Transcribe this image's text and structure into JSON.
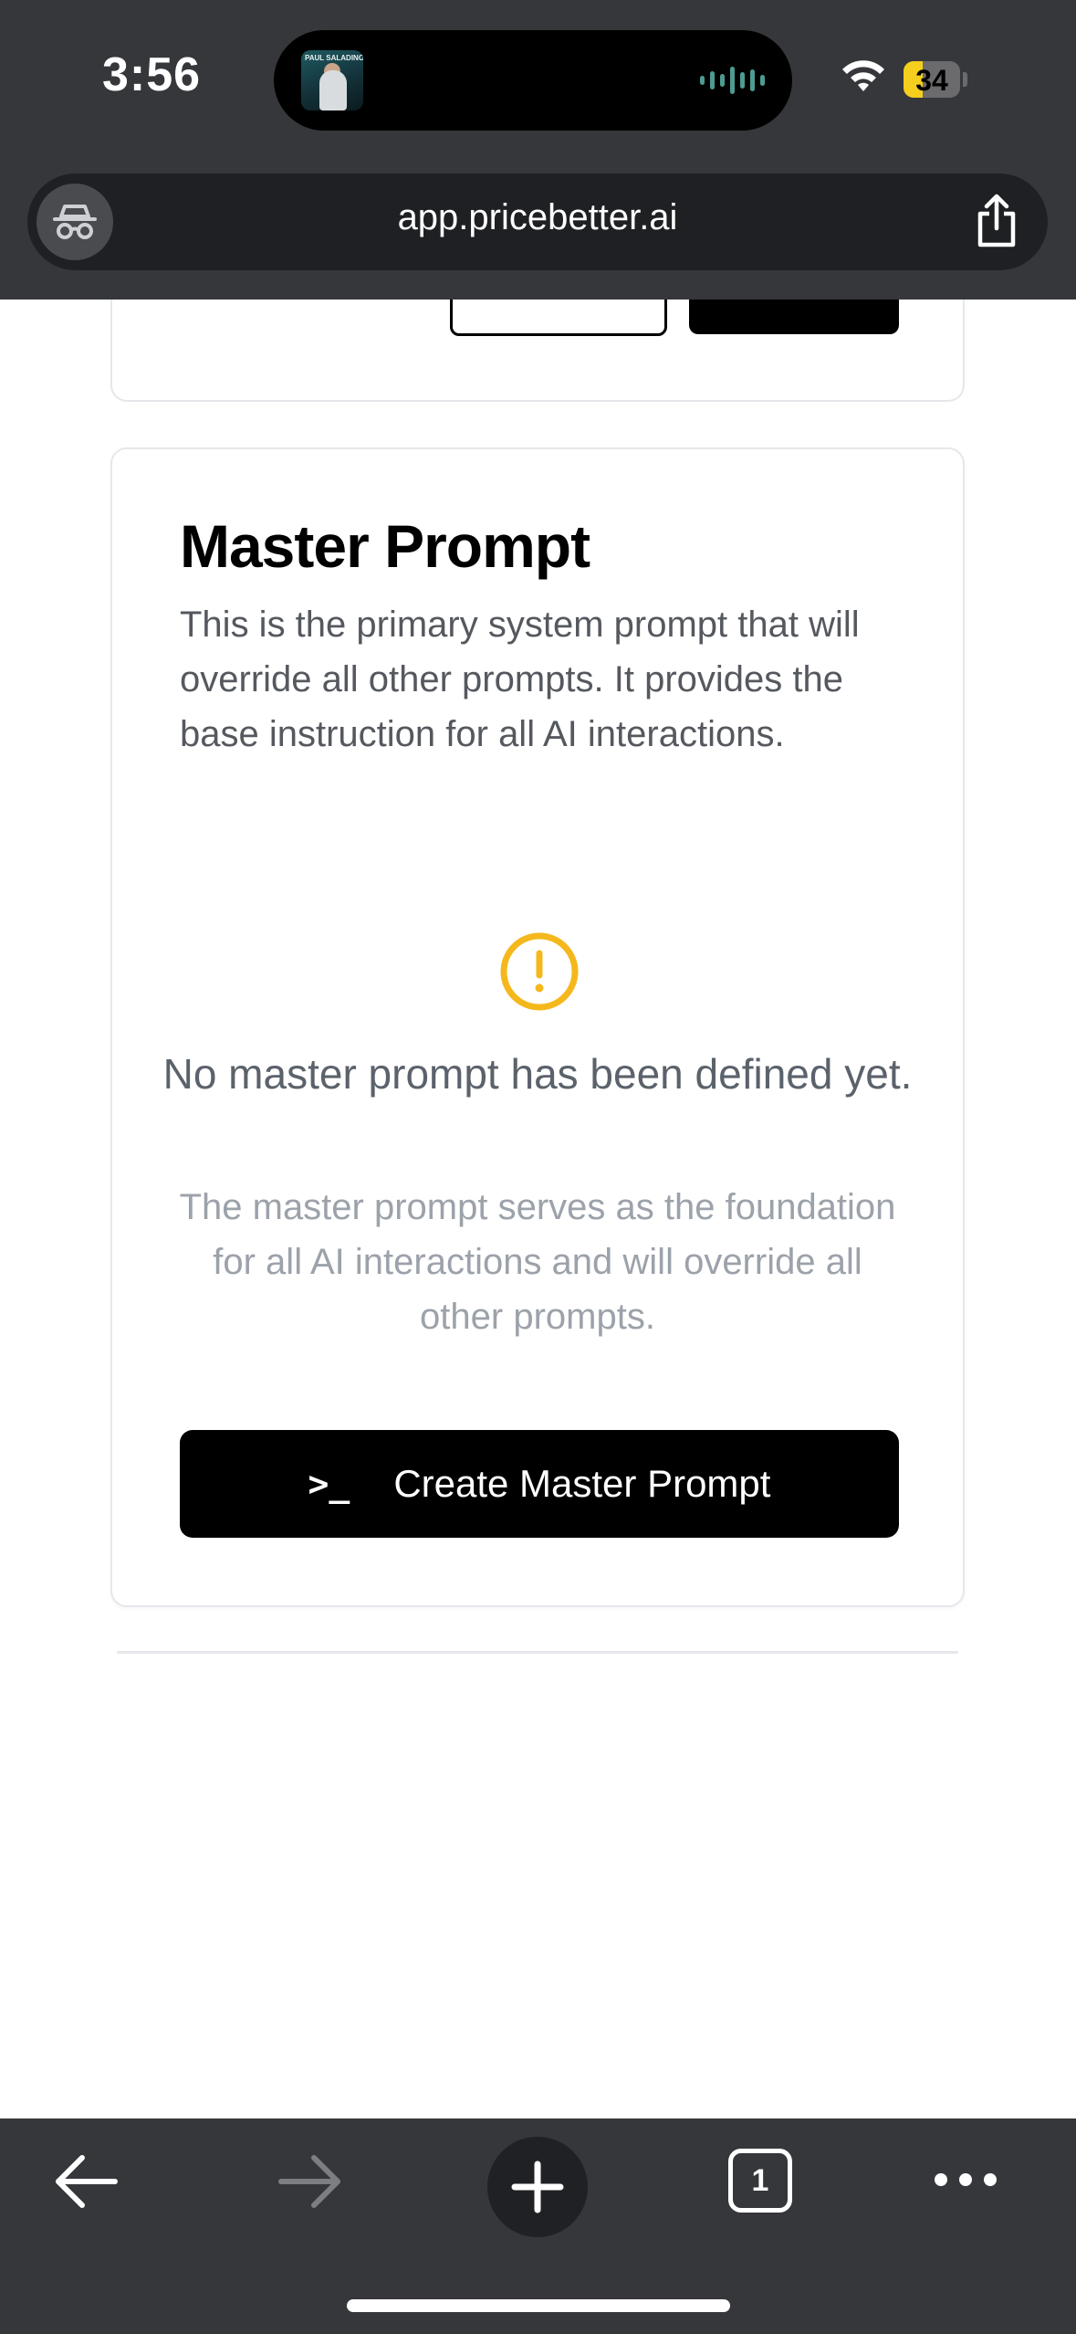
{
  "status_bar": {
    "time": "3:56",
    "now_playing_art_text": "PAUL SALADINO MD",
    "battery_level": "34",
    "battery_fraction": 0.34
  },
  "browser": {
    "url": "app.pricebetter.ai",
    "incognito_icon": "incognito-icon",
    "share_icon": "share-icon"
  },
  "master_prompt": {
    "title": "Master Prompt",
    "description": "This is the primary system prompt that will override all other prompts. It provides the base instruction for all AI interactions.",
    "warning_icon_color": "#f5b81c",
    "empty_title": "No master prompt has been defined yet.",
    "empty_subtitle": "The master prompt serves as the foundation for all AI interactions and will override all other prompts.",
    "create_button_icon": ">_",
    "create_button_label": "Create Master Prompt"
  },
  "toolbar": {
    "tab_count": "1"
  }
}
